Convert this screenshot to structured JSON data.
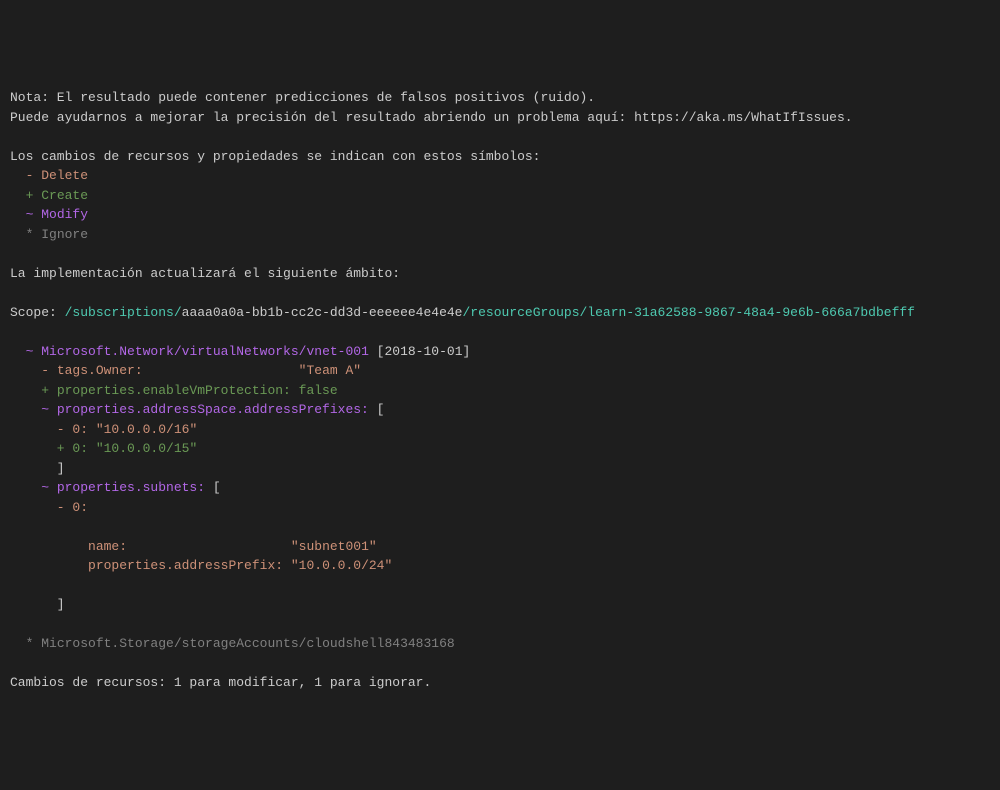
{
  "header": {
    "note_line1": "Nota: El resultado puede contener predicciones de falsos positivos (ruido).",
    "note_line2_prefix": "Puede ayudarnos a mejorar la precisión del resultado abriendo un problema aquí: ",
    "note_url": "https://aka.ms/WhatIfIssues",
    "note_line2_suffix": "."
  },
  "legend": {
    "intro": "Los cambios de recursos y propiedades se indican con estos símbolos:",
    "delete_sym": "  - ",
    "delete_label": "Delete",
    "create_sym": "  + ",
    "create_label": "Create",
    "modify_sym": "  ~ ",
    "modify_label": "Modify",
    "ignore_sym": "  * ",
    "ignore_label": "Ignore"
  },
  "scope_intro": "La implementación actualizará el siguiente ámbito:",
  "scope": {
    "prefix": "Scope: ",
    "path1": "/subscriptions/",
    "path_subid": "aaaa0a0a-bb1b-cc2c-dd3d-eeeeee4e4e4e",
    "path2": "/resourceGroups/learn-31a62588-9867-48a4-9e6b-666a7bdbefff"
  },
  "resource1": {
    "sym": "  ~ ",
    "path": "Microsoft.Network/virtualNetworks/vnet-001",
    "api": " [2018-10-01]",
    "line1_sym": "    - ",
    "line1_key": "tags.Owner:",
    "line1_pad": "                    ",
    "line1_val": "\"Team A\"",
    "line2_sym": "    + ",
    "line2_key": "properties.enableVmProtection: ",
    "line2_val": "false",
    "line3_sym": "    ~ ",
    "line3_key": "properties.addressSpace.addressPrefixes:",
    "line3_bracket": " [",
    "line4_sym": "      - ",
    "line4_key": "0: ",
    "line4_val": "\"10.0.0.0/16\"",
    "line5_sym": "      + ",
    "line5_key": "0: ",
    "line5_val": "\"10.0.0.0/15\"",
    "line6": "      ]",
    "line7_sym": "    ~ ",
    "line7_key": "properties.subnets:",
    "line7_bracket": " [",
    "line8_sym": "      - ",
    "line8_key": "0:",
    "line9_pad": "          ",
    "line9_key": "name:",
    "line9_pad2": "                     ",
    "line9_val": "\"subnet001\"",
    "line10_pad": "          ",
    "line10_key": "properties.addressPrefix: ",
    "line10_val": "\"10.0.0.0/24\"",
    "line11": "      ]"
  },
  "resource2": {
    "sym": "  * ",
    "path": "Microsoft.Storage/storageAccounts/cloudshell843483168"
  },
  "summary": "Cambios de recursos: 1 para modificar, 1 para ignorar."
}
